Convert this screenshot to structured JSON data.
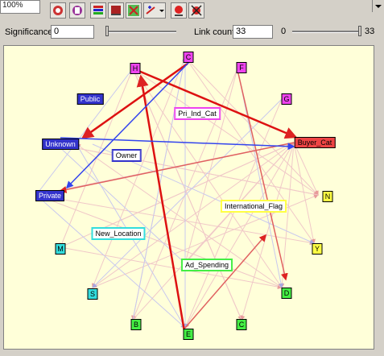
{
  "toolbar": {
    "zoom_value": "100%",
    "buttons": [
      "node-icon",
      "chart-icon",
      "grid-icon",
      "flag-icon",
      "layout-icon",
      "add-remove-icon",
      "marker-icon",
      "remove-marker-icon"
    ]
  },
  "controls": {
    "significance_label": "Significance:",
    "significance_value": "0",
    "link_count_label": "Link count:",
    "link_count_value": "33",
    "slider_min": "0",
    "slider_max": "33"
  },
  "nodes": {
    "H": "H",
    "C_top": "C",
    "F": "F",
    "G": "G",
    "Public": "Public",
    "Pri_Ind_Cat": "Pri_Ind_Cat",
    "Unknown": "Unknown",
    "Owner": "Owner",
    "Buyer_Cat": "Buyer_Cat",
    "Private": "Private",
    "N": "N",
    "International_Flag": "International_Flag",
    "New_Location": "New_Location",
    "M": "M",
    "Y": "Y",
    "Ad_Spending": "Ad_Spending",
    "S": "S",
    "D": "D",
    "B": "B",
    "E": "E",
    "C_bottom": "C"
  },
  "colors": {
    "blue_node": "#3333cc",
    "magenta_node": "#ee44ee",
    "red_node": "#ee4444",
    "yellow_node": "#ffff44",
    "cyan_node": "#33dddd",
    "green_node": "#44ee44",
    "strong_link": "#dd0000",
    "blue_link": "#3344ee"
  }
}
